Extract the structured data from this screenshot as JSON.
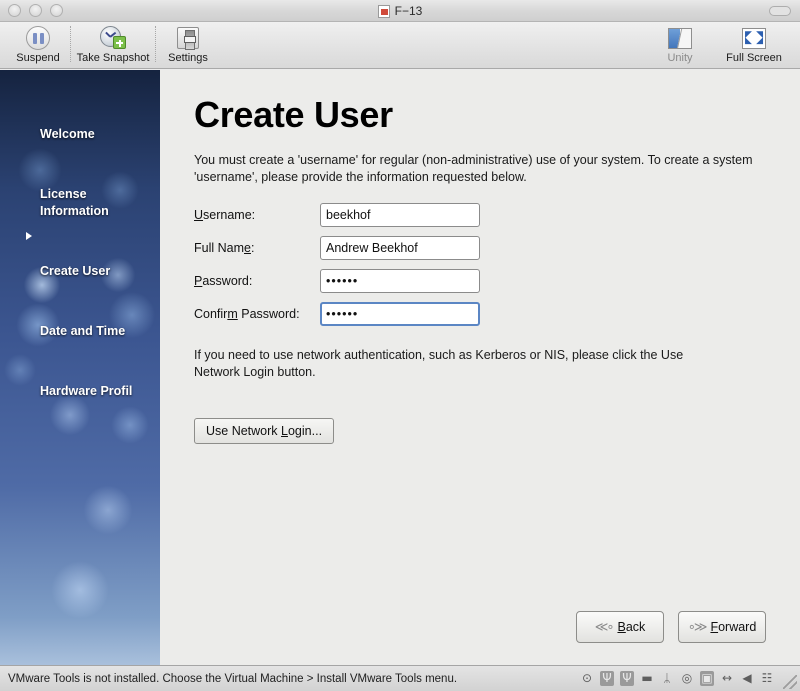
{
  "window": {
    "title": "F−13",
    "traffic_lights": [
      "close",
      "minimize",
      "zoom"
    ]
  },
  "toolbar": {
    "items": [
      {
        "label": "Suspend",
        "icon": "suspend-icon"
      },
      {
        "label": "Take Snapshot",
        "icon": "take-snapshot-icon"
      },
      {
        "label": "Settings",
        "icon": "settings-icon"
      }
    ],
    "right_items": [
      {
        "label": "Unity",
        "icon": "unity-icon"
      },
      {
        "label": "Full Screen",
        "icon": "full-screen-icon"
      }
    ]
  },
  "sidebar": {
    "items": [
      {
        "label": "Welcome",
        "current": false
      },
      {
        "label": "License\nInformation",
        "current": false
      },
      {
        "label": "Create User",
        "current": true
      },
      {
        "label": "Date and Time",
        "current": false
      },
      {
        "label": "Hardware Profil",
        "current": false
      }
    ]
  },
  "main": {
    "title": "Create User",
    "description": "You must create a 'username' for regular (non-administrative) use of your system.\nTo create a system 'username', please provide the information requested below.",
    "fields": [
      {
        "label_pre": "",
        "label_mnemonic": "U",
        "label_post": "sername:",
        "value": "beekhof",
        "placeholder": "",
        "type": "text",
        "focused": false,
        "name": "username"
      },
      {
        "label_pre": "Full Nam",
        "label_mnemonic": "e",
        "label_post": ":",
        "value": "Andrew Beekhof",
        "placeholder": "",
        "type": "text",
        "focused": false,
        "name": "full-name"
      },
      {
        "label_pre": "",
        "label_mnemonic": "P",
        "label_post": "assword:",
        "value": "••••••",
        "placeholder": "",
        "type": "password",
        "focused": false,
        "name": "password"
      },
      {
        "label_pre": "Confir",
        "label_mnemonic": "m",
        "label_post": " Password:",
        "value": "••••••",
        "placeholder": "",
        "type": "password",
        "focused": true,
        "name": "confirm-password"
      }
    ],
    "note": "If you need to use network authentication, such as Kerberos or NIS, please click the\nUse Network Login button.",
    "network_button": {
      "pre": "Use Network ",
      "mnemonic": "L",
      "post": "ogin..."
    },
    "back_button": {
      "pre": "",
      "mnemonic": "B",
      "post": "ack",
      "icon": "back-arrow-icon"
    },
    "forward_button": {
      "pre": "",
      "mnemonic": "F",
      "post": "orward",
      "icon": "forward-arrow-icon"
    }
  },
  "statusbar": {
    "message": "VMware Tools is not installed. Choose the Virtual Machine > Install VMware Tools menu.",
    "icons": [
      {
        "name": "camera-icon",
        "glyph": "⊙"
      },
      {
        "name": "usb-icon-1",
        "glyph": "Ψ"
      },
      {
        "name": "usb-icon-2",
        "glyph": "Ψ"
      },
      {
        "name": "floppy-icon",
        "glyph": "▬"
      },
      {
        "name": "bluetooth-icon",
        "glyph": "ᛦ"
      },
      {
        "name": "cd-drive-icon",
        "glyph": "◎"
      },
      {
        "name": "hard-disk-icon",
        "glyph": "▣"
      },
      {
        "name": "network-icon",
        "glyph": "↔"
      },
      {
        "name": "sound-icon",
        "glyph": "◀"
      },
      {
        "name": "printer-icon",
        "glyph": "☷"
      }
    ]
  },
  "colors": {
    "accent": "#5b86c4",
    "chrome": "#e3e3e3",
    "content_bg": "#ececea",
    "wallpaper": "#3c5691"
  }
}
